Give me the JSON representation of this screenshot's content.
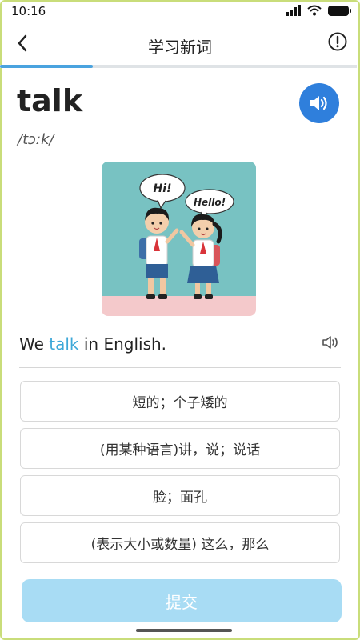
{
  "status_bar": {
    "time": "10:16"
  },
  "header": {
    "title": "学习新词"
  },
  "progress": {
    "fraction": 0.26
  },
  "word": {
    "text": "talk",
    "phonetic": "/tɔːk/"
  },
  "illustration": {
    "bubble_left": "Hi!",
    "bubble_right": "Hello!"
  },
  "sentence": {
    "before": "We ",
    "highlight": "talk",
    "after": " in English."
  },
  "options": [
    {
      "label": "短的；个子矮的"
    },
    {
      "label": "(用某种语言)讲，说；说话"
    },
    {
      "label": "脸；面孔"
    },
    {
      "label": "(表示大小或数量) 这么，那么"
    }
  ],
  "submit": {
    "label": "提交"
  },
  "colors": {
    "accent": "#2f7fdc",
    "highlight": "#3ea8d8",
    "submit_bg": "#a8dcf4",
    "progress": "#4aa3df"
  }
}
